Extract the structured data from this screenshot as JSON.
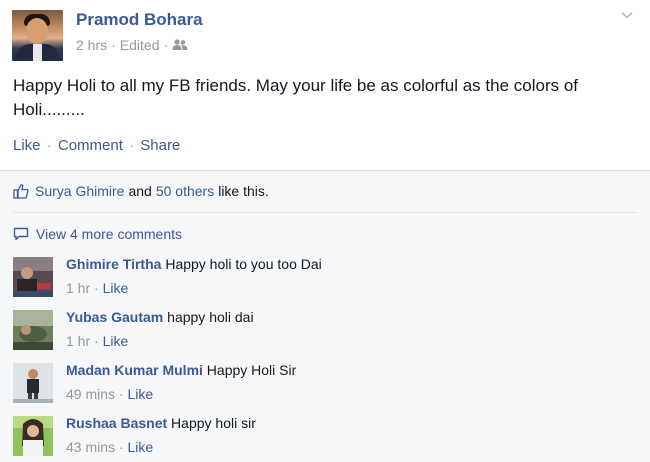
{
  "post": {
    "author": "Pramod Bohara",
    "time": "2 hrs",
    "edited": "Edited",
    "privacy_icon": "friends-icon",
    "text": "Happy Holi to all my FB friends. May your life be as colorful as the colors of Holi.........",
    "actions": {
      "like": "Like",
      "comment": "Comment",
      "share": "Share"
    }
  },
  "likes": {
    "first_name": "Surya Ghimire",
    "and": "and",
    "others": "50 others",
    "suffix": "like this."
  },
  "view_more": "View 4 more comments",
  "comments": [
    {
      "name": "Ghimire Tirtha",
      "text": "Happy holi to you too Dai",
      "time": "1 hr",
      "like": "Like"
    },
    {
      "name": "Yubas Gautam",
      "text": "happy holi dai",
      "time": "1 hr",
      "like": "Like"
    },
    {
      "name": "Madan Kumar Mulmi",
      "text": "Happy Holi Sir",
      "time": "49 mins",
      "like": "Like"
    },
    {
      "name": "Rushaa Basnet",
      "text": "Happy holi sir",
      "time": "43 mins",
      "like": "Like"
    }
  ],
  "colors": {
    "link": "#3b5998",
    "meta": "#9197a3",
    "ufi_bg": "#f6f7f8"
  }
}
